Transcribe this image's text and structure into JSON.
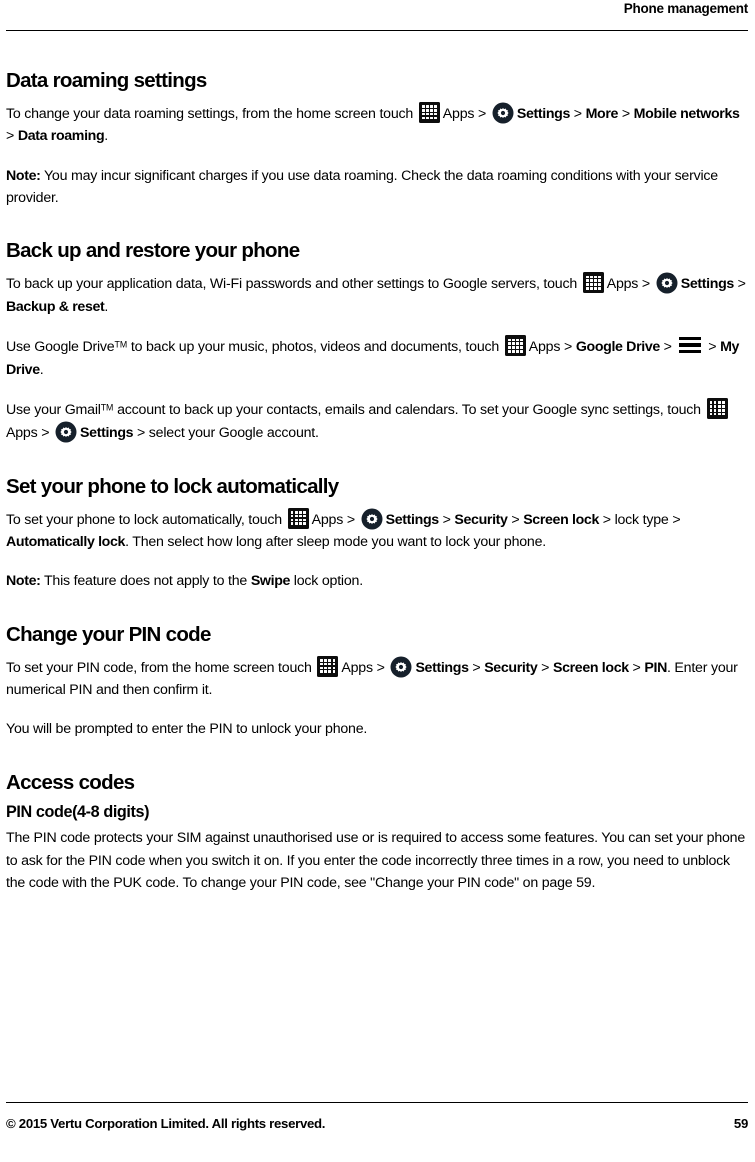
{
  "header": {
    "title": "Phone management"
  },
  "icons": {
    "apps": "apps-grid-icon",
    "settings": "settings-gear-icon",
    "menu": "hamburger-menu-icon"
  },
  "labels": {
    "apps": "Apps",
    "settings": "Settings",
    "arrow": ">"
  },
  "sections": [
    {
      "id": "data-roaming-settings",
      "heading": "Data roaming settings",
      "paragraphs": [
        {
          "id": "data-roaming-path",
          "parts": [
            {
              "t": "text",
              "v": "To change your data roaming settings, from the home screen touch "
            },
            {
              "t": "icon",
              "v": "apps"
            },
            {
              "t": "text",
              "v": "Apps"
            },
            {
              "t": "sep",
              "v": " > "
            },
            {
              "t": "icon",
              "v": "settings"
            },
            {
              "t": "bold",
              "v": "Settings"
            },
            {
              "t": "sep",
              "v": " > "
            },
            {
              "t": "bold",
              "v": "More"
            },
            {
              "t": "sep",
              "v": " > "
            },
            {
              "t": "bold",
              "v": "Mobile networks"
            },
            {
              "t": "sep",
              "v": " > "
            },
            {
              "t": "bold",
              "v": "Data roaming"
            },
            {
              "t": "text",
              "v": "."
            }
          ]
        },
        {
          "id": "data-roaming-note",
          "parts": [
            {
              "t": "bold",
              "v": "Note:"
            },
            {
              "t": "text",
              "v": " You may incur significant charges if you use data roaming. Check the data roaming conditions with your service provider."
            }
          ]
        }
      ]
    },
    {
      "id": "back-up-and-restore-your-phone",
      "heading": "Back up and restore your phone",
      "paragraphs": [
        {
          "id": "backup-google-servers",
          "parts": [
            {
              "t": "text",
              "v": "To back up your application data, Wi-Fi passwords and other settings to Google servers, touch "
            },
            {
              "t": "icon",
              "v": "apps"
            },
            {
              "t": "text",
              "v": "Apps"
            },
            {
              "t": "sep",
              "v": " > "
            },
            {
              "t": "icon",
              "v": "settings"
            },
            {
              "t": "bold",
              "v": "Settings"
            },
            {
              "t": "sep",
              "v": " > "
            },
            {
              "t": "bold",
              "v": "Backup & reset"
            },
            {
              "t": "text",
              "v": "."
            }
          ]
        },
        {
          "id": "backup-google-drive",
          "parts": [
            {
              "t": "text",
              "v": "Use Google Drive"
            },
            {
              "t": "tm",
              "v": "TM"
            },
            {
              "t": "text",
              "v": " to back up your music, photos, videos and documents, touch "
            },
            {
              "t": "icon",
              "v": "apps"
            },
            {
              "t": "text",
              "v": "Apps"
            },
            {
              "t": "sep",
              "v": " > "
            },
            {
              "t": "bold",
              "v": "Google Drive"
            },
            {
              "t": "sep",
              "v": " > "
            },
            {
              "t": "icon",
              "v": "menu"
            },
            {
              "t": "sep",
              "v": " > "
            },
            {
              "t": "bold",
              "v": "My Drive"
            },
            {
              "t": "text",
              "v": "."
            }
          ]
        },
        {
          "id": "backup-gmail-sync",
          "parts": [
            {
              "t": "text",
              "v": "Use your Gmail"
            },
            {
              "t": "tm",
              "v": "TM"
            },
            {
              "t": "text",
              "v": " account to back up your contacts, emails and calendars. To set your Google sync settings, touch "
            },
            {
              "t": "icon",
              "v": "apps"
            },
            {
              "t": "text",
              "v": "Apps"
            },
            {
              "t": "sep",
              "v": " > "
            },
            {
              "t": "icon",
              "v": "settings"
            },
            {
              "t": "bold",
              "v": "Settings"
            },
            {
              "t": "sep",
              "v": " > "
            },
            {
              "t": "text",
              "v": "select your Google account."
            }
          ]
        }
      ]
    },
    {
      "id": "set-your-phone-to-lock-automatically",
      "heading": "Set your phone to lock automatically",
      "paragraphs": [
        {
          "id": "auto-lock-path",
          "parts": [
            {
              "t": "text",
              "v": "To set your phone to lock automatically, touch "
            },
            {
              "t": "icon",
              "v": "apps"
            },
            {
              "t": "text",
              "v": "Apps"
            },
            {
              "t": "sep",
              "v": " > "
            },
            {
              "t": "icon",
              "v": "settings"
            },
            {
              "t": "bold",
              "v": "Settings"
            },
            {
              "t": "sep",
              "v": " > "
            },
            {
              "t": "bold",
              "v": "Security"
            },
            {
              "t": "sep",
              "v": " > "
            },
            {
              "t": "bold",
              "v": "Screen lock"
            },
            {
              "t": "sep",
              "v": " > "
            },
            {
              "t": "text",
              "v": "lock type"
            },
            {
              "t": "sep",
              "v": " > "
            },
            {
              "t": "bold",
              "v": "Automatically lock"
            },
            {
              "t": "text",
              "v": ". Then select how long after sleep mode you want to lock your phone."
            }
          ]
        },
        {
          "id": "auto-lock-note",
          "parts": [
            {
              "t": "bold",
              "v": "Note:"
            },
            {
              "t": "text",
              "v": " This feature does not apply to the "
            },
            {
              "t": "bold",
              "v": "Swipe"
            },
            {
              "t": "text",
              "v": " lock option."
            }
          ]
        }
      ]
    },
    {
      "id": "change-your-pin-code",
      "heading": "Change your PIN code",
      "paragraphs": [
        {
          "id": "pin-code-path",
          "parts": [
            {
              "t": "text",
              "v": "To set your PIN code, from the home screen touch "
            },
            {
              "t": "icon",
              "v": "apps"
            },
            {
              "t": "text",
              "v": "Apps"
            },
            {
              "t": "sep",
              "v": " > "
            },
            {
              "t": "icon",
              "v": "settings"
            },
            {
              "t": "bold",
              "v": "Settings"
            },
            {
              "t": "sep",
              "v": " > "
            },
            {
              "t": "bold",
              "v": "Security"
            },
            {
              "t": "sep",
              "v": " > "
            },
            {
              "t": "bold",
              "v": "Screen lock"
            },
            {
              "t": "sep",
              "v": " > "
            },
            {
              "t": "bold",
              "v": "PIN"
            },
            {
              "t": "text",
              "v": ". Enter your numerical PIN and then confirm it."
            }
          ]
        },
        {
          "id": "pin-code-prompt",
          "parts": [
            {
              "t": "text",
              "v": "You will be prompted to enter the PIN to unlock your phone."
            }
          ]
        }
      ]
    },
    {
      "id": "access-codes",
      "heading": "Access codes",
      "subheading": "PIN code(4-8 digits)",
      "paragraphs": [
        {
          "id": "pin-code-description",
          "parts": [
            {
              "t": "text",
              "v": "The PIN code protects your SIM against unauthorised use or is required to access some features. You can set your phone to ask for the PIN code when you switch it on. If you enter the code incorrectly three times in a row, you need to unblock the code with the PUK code. To change your PIN code, see \"Change your PIN code\" on page 59."
            }
          ]
        }
      ]
    }
  ],
  "footer": {
    "copyright": "© 2015 Vertu Corporation Limited. All rights reserved.",
    "page_number": "59"
  }
}
